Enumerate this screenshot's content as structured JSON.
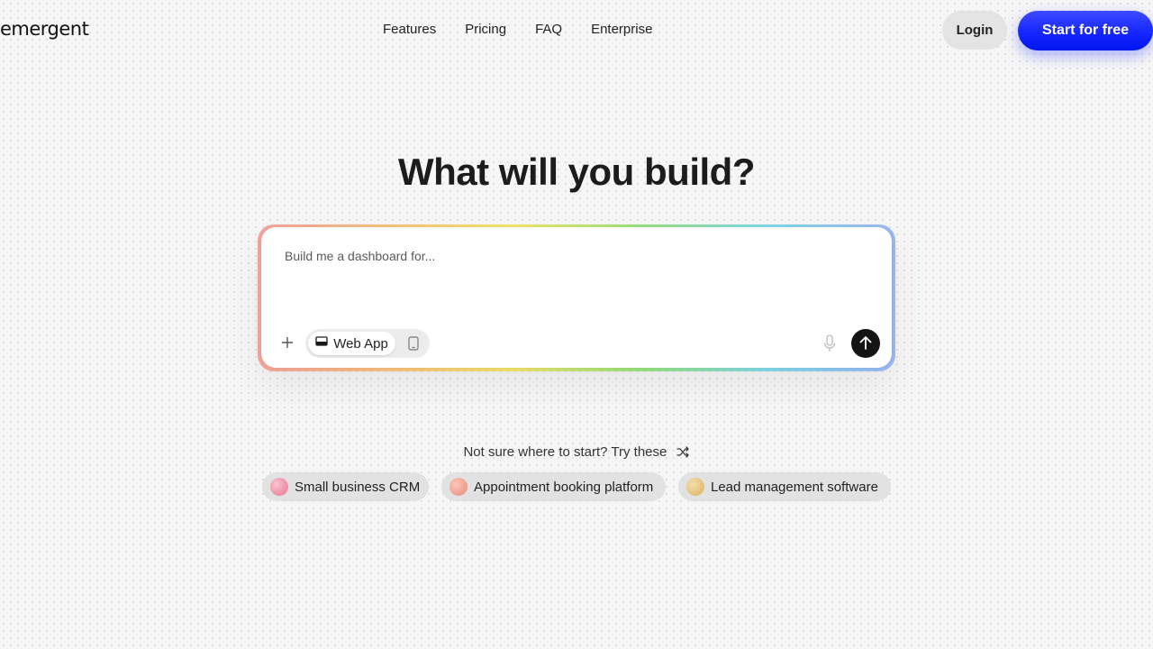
{
  "header": {
    "logo_text": "emergent",
    "nav": [
      "Features",
      "Pricing",
      "FAQ",
      "Enterprise"
    ],
    "login_label": "Login",
    "cta_label": "Start for free",
    "cta_color": "#1626ff"
  },
  "main": {
    "headline": "What will you build?",
    "prompt": {
      "placeholder": "Build me a dashboard for...",
      "value": "",
      "app_type_selected": "Web App",
      "icons": [
        "plus-icon",
        "laptop-icon",
        "mobile-phone-icon",
        "microphone-icon",
        "arrow-up-icon"
      ]
    },
    "suggestions": {
      "heading": "Not sure where to start? Try these",
      "chips": [
        {
          "label": "Small business CRM",
          "orb_color": "#ee8aa0"
        },
        {
          "label": "Appointment booking platform",
          "orb_color": "#f0a090"
        },
        {
          "label": "Lead management software",
          "orb_color": "#e6c27a"
        }
      ]
    }
  }
}
